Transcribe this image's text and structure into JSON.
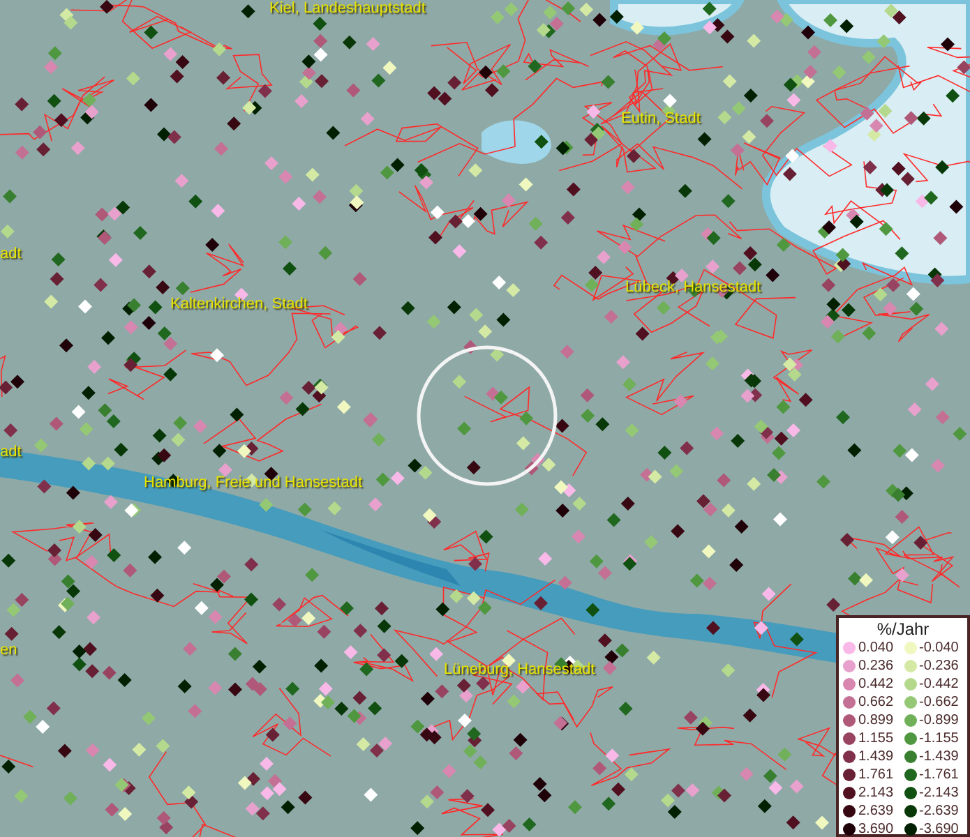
{
  "map": {
    "place_labels": [
      {
        "text": "Kiel, Landeshauptstadt"
      },
      {
        "text": "Eutin, Stadt"
      },
      {
        "text": "adt"
      },
      {
        "text": "Lübeck, Hansestadt"
      },
      {
        "text": "Kaltenkirchen, Stadt"
      },
      {
        "text": "adt"
      },
      {
        "text": "Hamburg, Freie und Hansestadt"
      },
      {
        "text": "en"
      },
      {
        "text": "Lüneburg, Hansestadt"
      }
    ]
  },
  "legend": {
    "title": "%/Jahr",
    "entries": [
      {
        "value": "0.040",
        "color": "#f8b8e8"
      },
      {
        "value": "-0.040",
        "color": "#f0f8c0"
      },
      {
        "value": "0.236",
        "color": "#e8a0cc"
      },
      {
        "value": "-0.236",
        "color": "#d4eaa4"
      },
      {
        "value": "0.442",
        "color": "#d888b0"
      },
      {
        "value": "-0.442",
        "color": "#b4d88c"
      },
      {
        "value": "0.662",
        "color": "#c47094"
      },
      {
        "value": "-0.662",
        "color": "#94c874"
      },
      {
        "value": "0.899",
        "color": "#b05878"
      },
      {
        "value": "-0.899",
        "color": "#70b058"
      },
      {
        "value": "1.155",
        "color": "#984460"
      },
      {
        "value": "-1.155",
        "color": "#509840"
      },
      {
        "value": "1.439",
        "color": "#80304a"
      },
      {
        "value": "-1.439",
        "color": "#388030"
      },
      {
        "value": "1.761",
        "color": "#682034"
      },
      {
        "value": "-1.761",
        "color": "#206820"
      },
      {
        "value": "2.143",
        "color": "#501020"
      },
      {
        "value": "-2.143",
        "color": "#105010"
      },
      {
        "value": "2.639",
        "color": "#380812"
      },
      {
        "value": "-2.639",
        "color": "#083808"
      },
      {
        "value": "3.690",
        "color": "#200008"
      },
      {
        "value": "-3.690",
        "color": "#002000"
      }
    ]
  }
}
